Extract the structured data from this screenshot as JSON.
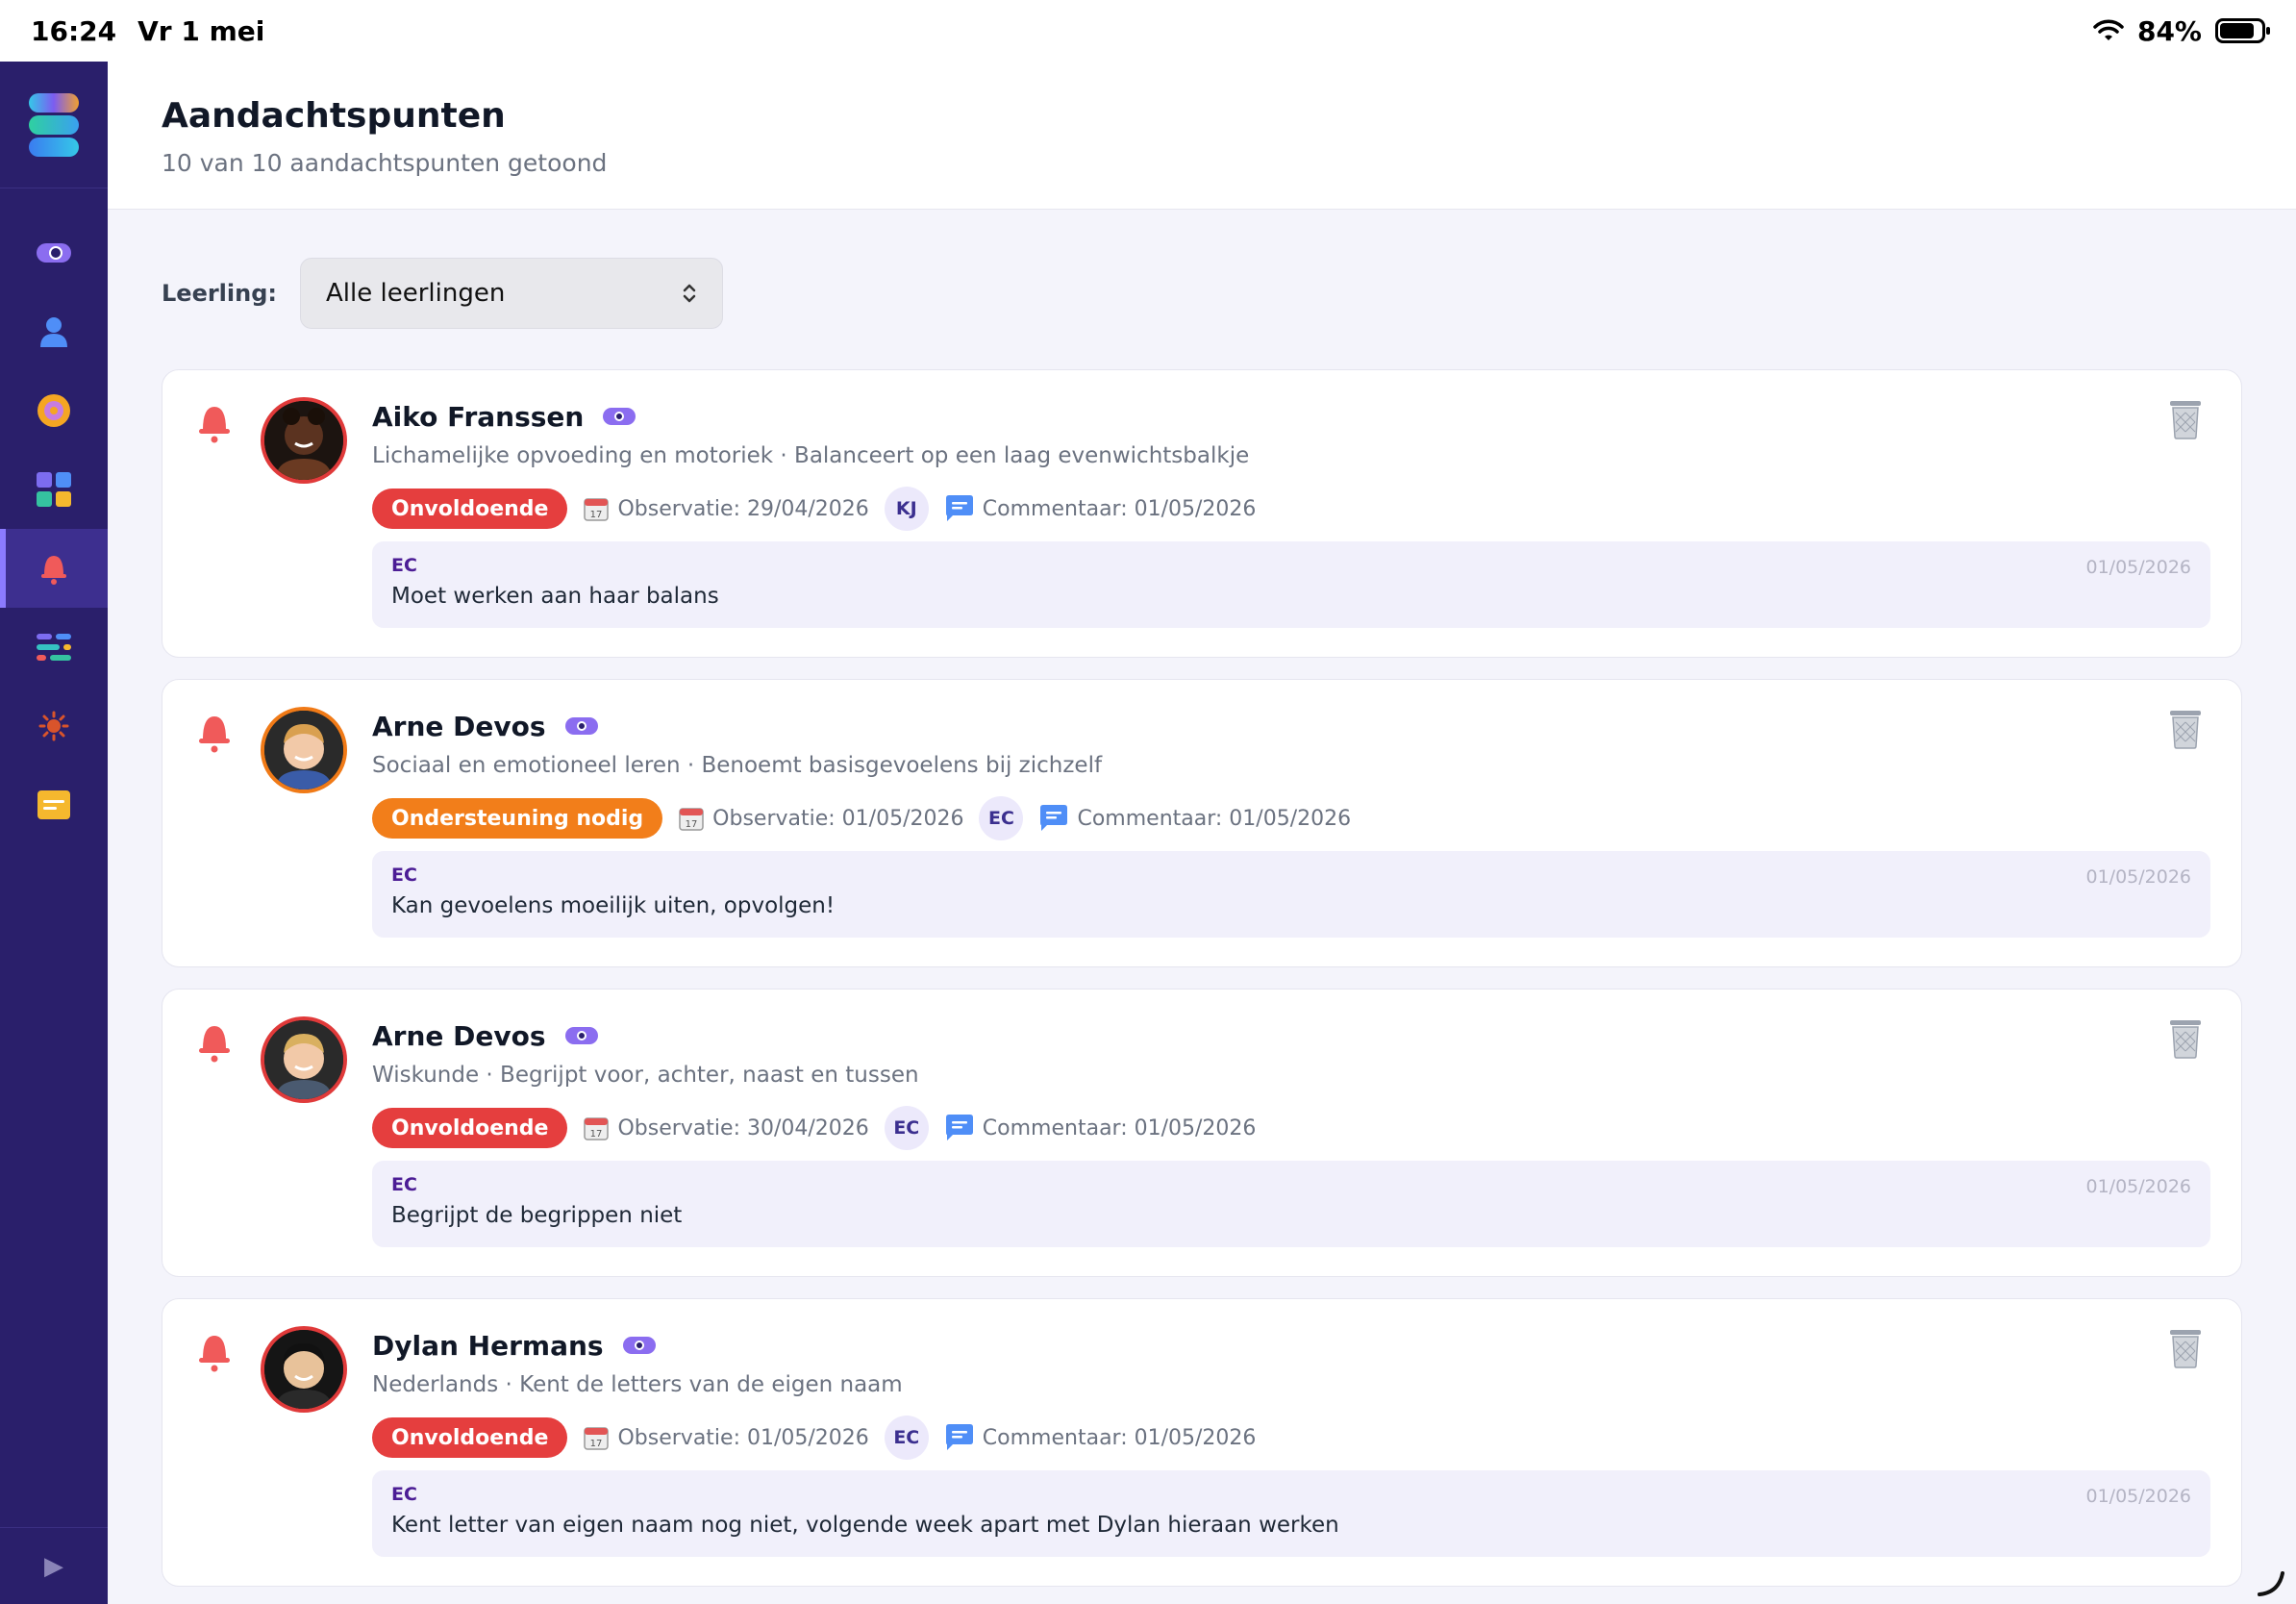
{
  "status_bar": {
    "time": "16:24",
    "date": "Vr 1 mei",
    "battery": "84%",
    "battery_level": 0.84
  },
  "sidebar": {
    "items": [
      {
        "icon": "eye-toggle-icon",
        "color": "#8b6df0"
      },
      {
        "icon": "user-icon",
        "color": "#4f8ef7"
      },
      {
        "icon": "target-icon",
        "color": "#f5a623"
      },
      {
        "icon": "grid-icon",
        "color": "#7c6cf0"
      },
      {
        "icon": "bell-icon",
        "color": "#f05a5a",
        "active": true
      },
      {
        "icon": "sliders-icon",
        "color": "#35c2c2"
      },
      {
        "icon": "sun-icon",
        "color": "#d9542b"
      },
      {
        "icon": "card-icon",
        "color": "#f5b82e"
      }
    ],
    "collapse_glyph": "▶"
  },
  "header": {
    "title": "Aandachtspunten",
    "subtitle": "10 van 10 aandachtspunten getoond"
  },
  "filter": {
    "label": "Leerling:",
    "selected": "Alle leerlingen"
  },
  "cards": [
    {
      "name": "Aiko Franssen",
      "subject": "Lichamelijke opvoeding en motoriek · Balanceert op een laag evenwichtsbalkje",
      "status": "Onvoldoende",
      "status_color": "#e53e3e",
      "observation": "Observatie: 29/04/2026",
      "observer_initials": "KJ",
      "comment_date_label": "Commentaar: 01/05/2026",
      "comment": {
        "author": "EC",
        "date": "01/05/2026",
        "text": "Moet werken aan haar balans"
      }
    },
    {
      "name": "Arne Devos",
      "subject": "Sociaal en emotioneel leren · Benoemt basisgevoelens bij zichzelf",
      "status": "Ondersteuning nodig",
      "status_color": "#f27e1a",
      "observation": "Observatie: 01/05/2026",
      "observer_initials": "EC",
      "comment_date_label": "Commentaar: 01/05/2026",
      "comment": {
        "author": "EC",
        "date": "01/05/2026",
        "text": "Kan gevoelens moeilijk uiten, opvolgen!"
      }
    },
    {
      "name": "Arne Devos",
      "subject": "Wiskunde · Begrijpt voor, achter, naast en tussen",
      "status": "Onvoldoende",
      "status_color": "#e53e3e",
      "observation": "Observatie: 30/04/2026",
      "observer_initials": "EC",
      "comment_date_label": "Commentaar: 01/05/2026",
      "comment": {
        "author": "EC",
        "date": "01/05/2026",
        "text": "Begrijpt de begrippen niet"
      }
    },
    {
      "name": "Dylan Hermans",
      "subject": "Nederlands · Kent de letters van de eigen naam",
      "status": "Onvoldoende",
      "status_color": "#e53e3e",
      "observation": "Observatie: 01/05/2026",
      "observer_initials": "EC",
      "comment_date_label": "Commentaar: 01/05/2026",
      "comment": {
        "author": "EC",
        "date": "01/05/2026",
        "text": "Kent letter van eigen naam nog niet, volgende week apart met Dylan hieraan werken"
      }
    }
  ]
}
